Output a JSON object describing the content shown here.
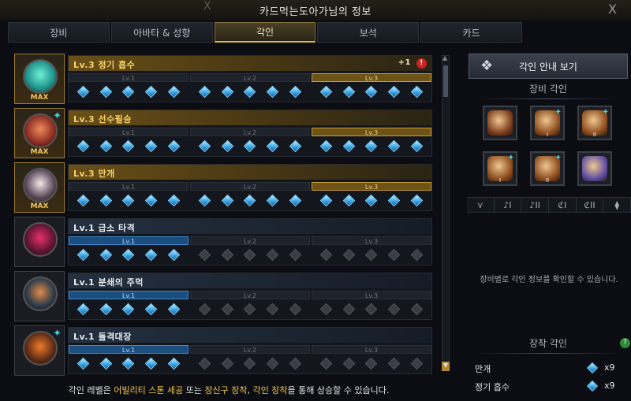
{
  "window": {
    "title": "카드먹는도아가님의 정보",
    "close_glyph": "X",
    "close_glyph_left": "X"
  },
  "tabs": [
    {
      "label": "장비",
      "active": false
    },
    {
      "label": "아바타 & 성향",
      "active": false
    },
    {
      "label": "각인",
      "active": true
    },
    {
      "label": "보석",
      "active": false
    },
    {
      "label": "카드",
      "active": false
    }
  ],
  "engravings": [
    {
      "name": "Lv.3 정기 흡수",
      "level": 3,
      "max_label": "MAX",
      "tier": "gold",
      "plus": "+1",
      "alert": "!",
      "spark": "",
      "colors": {
        "orb": "#1f8f8a",
        "core": "#6ef0d8"
      }
    },
    {
      "name": "Lv.3 선수필승",
      "level": 3,
      "max_label": "MAX",
      "tier": "gold",
      "plus": "",
      "alert": "",
      "spark": "✦",
      "colors": {
        "orb": "#8a2c22",
        "core": "#f08a5a"
      }
    },
    {
      "name": "Lv.3 만개",
      "level": 3,
      "max_label": "MAX",
      "tier": "gold",
      "plus": "",
      "alert": "",
      "spark": "",
      "colors": {
        "orb": "#5a4a5a",
        "core": "#f2e8ea"
      }
    },
    {
      "name": "Lv.1 급소 타격",
      "level": 1,
      "max_label": "",
      "tier": "blue",
      "plus": "",
      "alert": "",
      "spark": "",
      "colors": {
        "orb": "#5a1430",
        "core": "#e8306a"
      }
    },
    {
      "name": "Lv.1 분쇄의 주먹",
      "level": 1,
      "max_label": "",
      "tier": "blue",
      "plus": "",
      "alert": "",
      "spark": "",
      "colors": {
        "orb": "#2a3a4a",
        "core": "#e08a4a"
      }
    },
    {
      "name": "Lv.1 돌격대장",
      "level": 1,
      "max_label": "",
      "tier": "blue",
      "plus": "",
      "alert": "",
      "spark": "✦",
      "colors": {
        "orb": "#5a2a14",
        "core": "#f07a2a"
      }
    }
  ],
  "level_labels": [
    "Lv.1",
    "Lv.2",
    "Lv.3"
  ],
  "gems_per_level": 5,
  "footer": {
    "prefix": "각인 레벨은 ",
    "hl1": "어빌리티 스톤 세공",
    "mid1": " 또는 ",
    "hl2": "장신구 장착",
    "mid2": ", ",
    "hl3": "각인 장착",
    "suffix": "을 통해 상승할 수 있습니다."
  },
  "right_panel": {
    "guide_button": "각인 안내 보기",
    "equip_title": "장비 각인",
    "equip_slots": [
      {
        "name": "necklace",
        "num": "",
        "spark": false,
        "color": "#7a3a1a"
      },
      {
        "name": "earring-1",
        "num": "I",
        "spark": true,
        "color": "#8a4a1c"
      },
      {
        "name": "earring-2",
        "num": "II",
        "spark": true,
        "color": "#8a4a1c"
      },
      {
        "name": "ring-1",
        "num": "I",
        "spark": true,
        "color": "#8a4a1c"
      },
      {
        "name": "ring-2",
        "num": "II",
        "spark": true,
        "color": "#8a4a1c"
      },
      {
        "name": "ability-stone",
        "num": "",
        "spark": false,
        "color": "#5a4aa0"
      }
    ],
    "categories": [
      "⋎",
      "♪I",
      "♪II",
      "ℭI",
      "ℭII",
      "⧫"
    ],
    "info_text": "장비별로 각인 정보를 확인할 수 있습니다.",
    "equipped_title": "장착 각인",
    "help": "?",
    "equipped": [
      {
        "name": "만개",
        "count": "x9"
      },
      {
        "name": "정기 흡수",
        "count": "x9"
      }
    ]
  }
}
